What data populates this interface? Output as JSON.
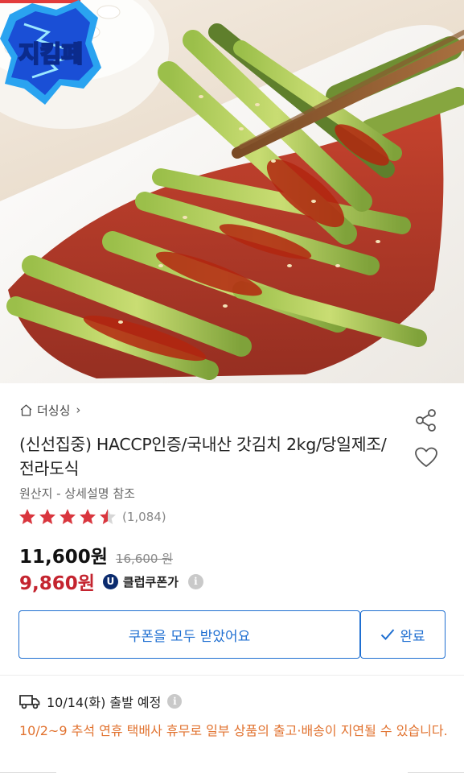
{
  "hero": {
    "badge_text": "지킴페",
    "alt": "product-photo"
  },
  "store": {
    "name": "더싱싱",
    "chevron": "›"
  },
  "product": {
    "title": "(신선집중) HACCP인증/국내산 갓김치 2kg/당일제조/전라도식",
    "origin": "원산지 - 상세설명 참조"
  },
  "rating": {
    "value": 4.5,
    "max": 5,
    "review_count": "(1,084)"
  },
  "price": {
    "sale": "11,600원",
    "original": "16,600 원",
    "coupon": "9,860원",
    "club_icon": "U",
    "club_label": "클럽쿠폰가",
    "info_icon": "i"
  },
  "actions": {
    "coupon_button": "쿠폰을 모두 받았어요",
    "done_button": "완료"
  },
  "shipping": {
    "date": "10/14(화) 출발 예정",
    "info_icon": "i",
    "notice": "10/2~9 추석 연휴 택배사 휴무로 일부 상품의 출고·배송이 지연될 수 있습니다."
  },
  "colors": {
    "accent_blue": "#1f6fd1",
    "coupon_red": "#c4242f",
    "star_red": "#d9363e",
    "notice_orange": "#e1722f",
    "club_navy": "#0b2b6e"
  }
}
